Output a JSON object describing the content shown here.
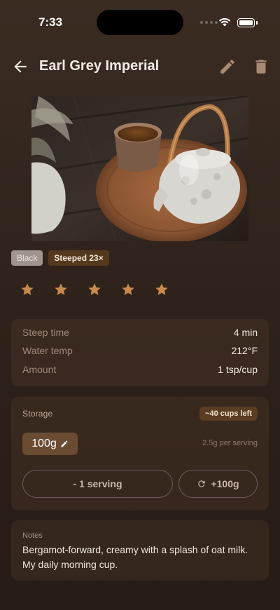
{
  "status_bar": {
    "time": "7:33"
  },
  "header": {
    "title": "Earl Grey Imperial",
    "back_icon": "arrow-left-icon",
    "edit_icon": "pencil-icon",
    "delete_icon": "trash-icon"
  },
  "hero": {
    "alt": "Cup of tea and white teapot on a wooden tray"
  },
  "tags": {
    "type": "Black",
    "steeped": "Steeped 23×"
  },
  "rating": {
    "stars": 5,
    "max": 5,
    "color": "#c78a4e"
  },
  "params": [
    {
      "label": "Steep time",
      "value": "4 min"
    },
    {
      "label": "Water temp",
      "value": "212°F"
    },
    {
      "label": "Amount",
      "value": "1 tsp/cup"
    }
  ],
  "storage": {
    "label": "Storage",
    "cups_left": "~40 cups left",
    "amount": "100g",
    "per_serving": "2.5g per serving",
    "minus_label": "- 1 serving",
    "plus_label": "+100g"
  },
  "notes": {
    "label": "Notes",
    "text": "Bergamot-forward, creamy with a splash of oat milk. My daily morning cup."
  },
  "colors": {
    "accent": "#c78a4e",
    "background": "#2f231b"
  }
}
